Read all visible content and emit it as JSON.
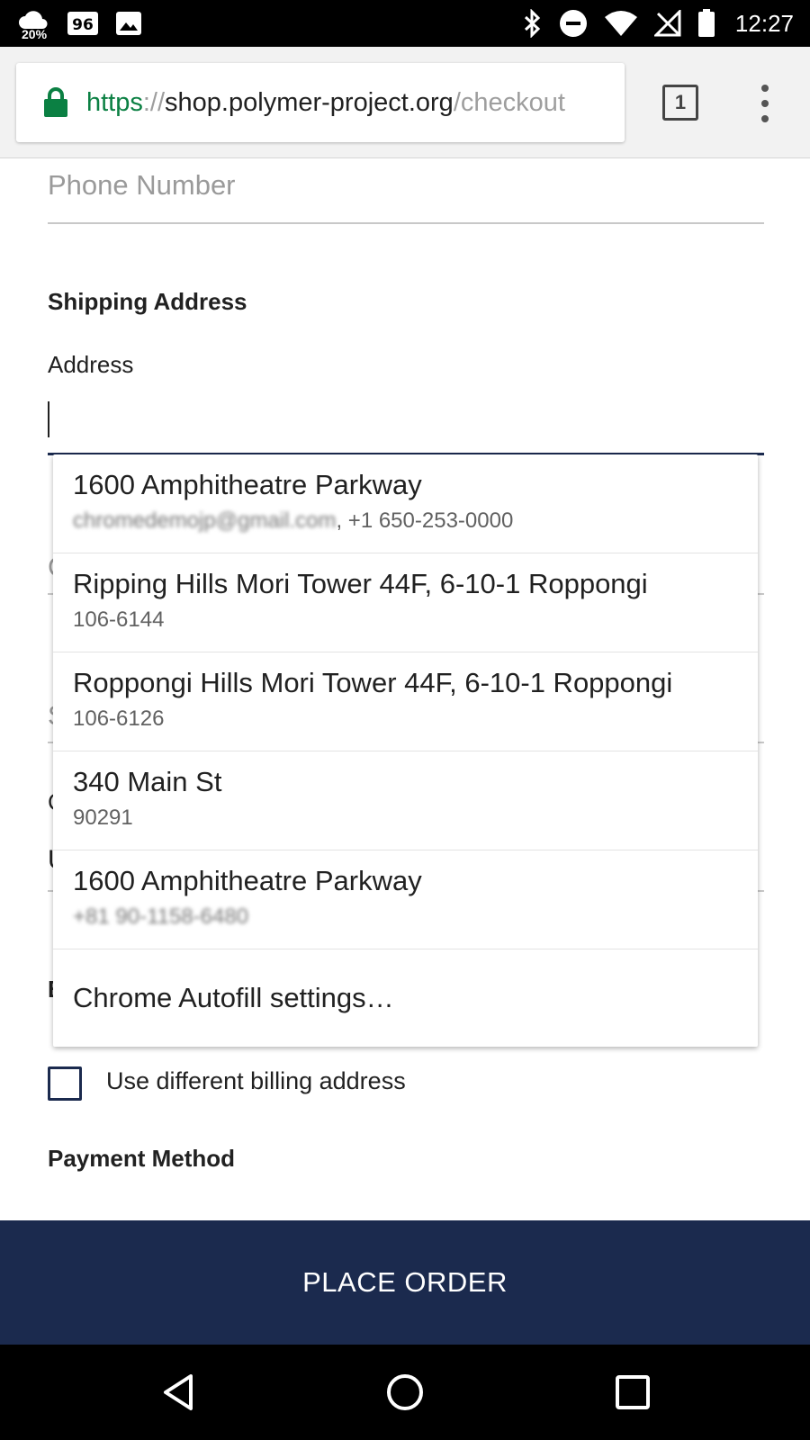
{
  "status_bar": {
    "battery_saver_percent": "20%",
    "time": "12:27",
    "icons": [
      "battery-saver-icon",
      "data-icon",
      "image-icon",
      "bluetooth-icon",
      "do-not-disturb-icon",
      "wifi-icon",
      "no-signal-icon",
      "battery-icon"
    ]
  },
  "browser": {
    "url_scheme": "https",
    "url_separator": "://",
    "url_host": "shop.polymer-project.org",
    "url_path": "/checkout",
    "tab_count": "1"
  },
  "form": {
    "phone_placeholder": "Phone Number",
    "shipping_heading": "Shipping Address",
    "address_label": "Address",
    "address_value": "",
    "billing_checkbox_label": "Use different billing address",
    "billing_checked": false,
    "payment_heading": "Payment Method",
    "partial_glyphs": [
      "C",
      "S",
      "C",
      "U",
      "B"
    ]
  },
  "autofill": {
    "items": [
      {
        "line1": "1600 Amphitheatre Parkway",
        "line2_blurred": "chromedemojp@gmail.com",
        "line2_rest": ", +1 650-253-0000"
      },
      {
        "line1": "Ripping Hills Mori Tower 44F, 6-10-1 Roppongi",
        "line2": "106-6144"
      },
      {
        "line1": "Roppongi Hills Mori Tower 44F, 6-10-1 Roppongi",
        "line2": "106-6126"
      },
      {
        "line1": "340 Main St",
        "line2": "90291"
      },
      {
        "line1": "1600 Amphitheatre Parkway",
        "line2_blurred": "+81 90-1158-6480"
      }
    ],
    "settings_label": "Chrome Autofill settings…"
  },
  "actions": {
    "place_order_label": "PLACE ORDER"
  },
  "colors": {
    "primary": "#1b2a4e",
    "secure_green": "#0b8043"
  }
}
